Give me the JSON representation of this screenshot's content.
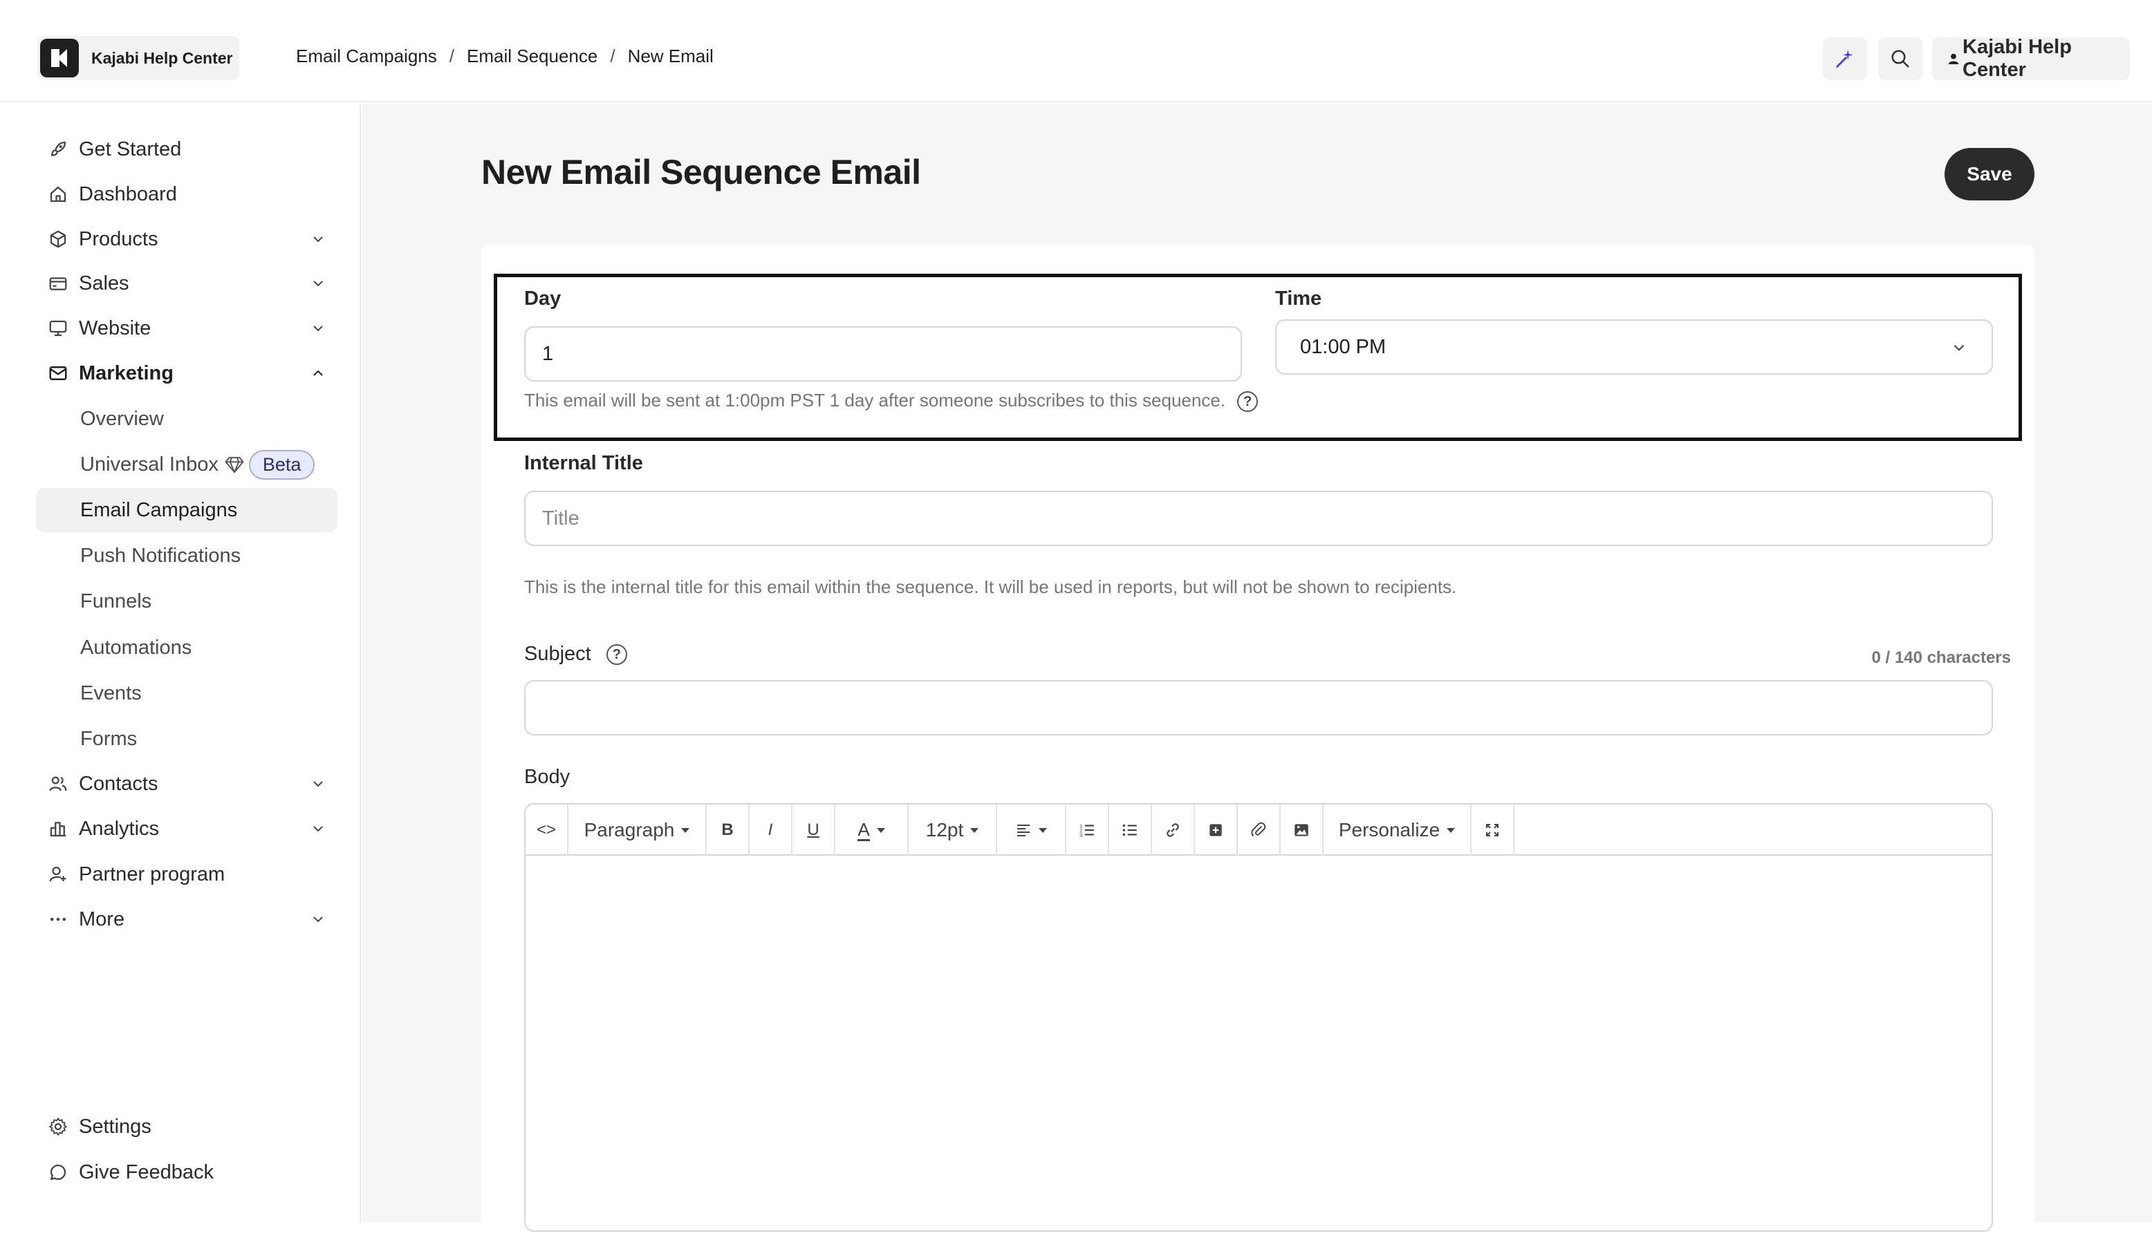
{
  "app": {
    "brand": "Kajabi Help Center",
    "account": "Kajabi Help Center"
  },
  "breadcrumb": [
    "Email Campaigns",
    "Email Sequence",
    "New Email"
  ],
  "sidebar": {
    "items": [
      {
        "label": "Get Started"
      },
      {
        "label": "Dashboard"
      },
      {
        "label": "Products"
      },
      {
        "label": "Sales"
      },
      {
        "label": "Website"
      },
      {
        "label": "Marketing"
      },
      {
        "label": "Contacts"
      },
      {
        "label": "Analytics"
      },
      {
        "label": "Partner program"
      },
      {
        "label": "More"
      }
    ],
    "marketing_sub": [
      {
        "label": "Overview"
      },
      {
        "label": "Universal Inbox"
      },
      {
        "label": "Email Campaigns"
      },
      {
        "label": "Push Notifications"
      },
      {
        "label": "Funnels"
      },
      {
        "label": "Automations"
      },
      {
        "label": "Events"
      },
      {
        "label": "Forms"
      }
    ],
    "beta_badge": "Beta",
    "bottom": [
      {
        "label": "Settings"
      },
      {
        "label": "Give Feedback"
      }
    ]
  },
  "page": {
    "title": "New Email Sequence Email",
    "save_label": "Save"
  },
  "schedule": {
    "day_label": "Day",
    "day_value": "1",
    "time_label": "Time",
    "time_value": "01:00 PM",
    "help": "This email will be sent at 1:00pm PST 1 day after someone subscribes to this sequence."
  },
  "internal_title": {
    "label": "Internal Title",
    "placeholder": "Title",
    "help": "This is the internal title for this email within the sequence. It will be used in reports, but will not be shown to recipients."
  },
  "subject": {
    "label": "Subject",
    "counter": "0 / 140 characters",
    "value": ""
  },
  "body": {
    "label": "Body",
    "toolbar": {
      "paragraph": "Paragraph",
      "font_size": "12pt",
      "personalize": "Personalize"
    }
  },
  "colors": {
    "accent": "#2b2b2b",
    "ai_icon": "#4b3fd6",
    "beta_bg": "#e8eaff"
  }
}
